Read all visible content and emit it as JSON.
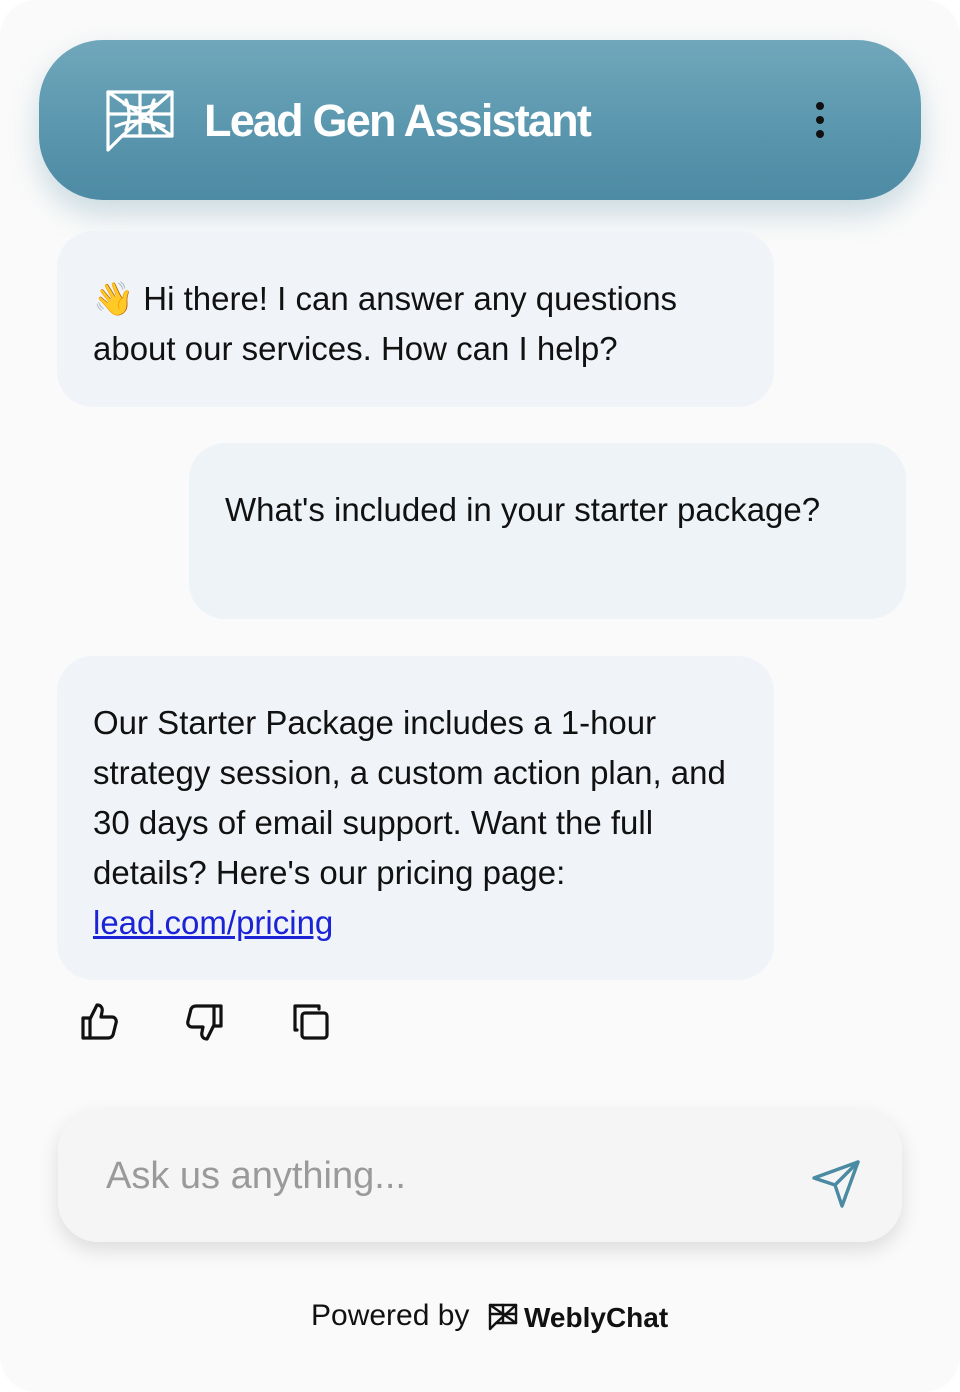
{
  "header": {
    "title": "Lead Gen Assistant",
    "logo_icon": "chat-web-logo-icon",
    "menu_icon": "vertical-dots-icon"
  },
  "messages": [
    {
      "role": "bot",
      "emoji": "👋",
      "text": " Hi there! I can answer any questions about our services. How can I help?"
    },
    {
      "role": "user",
      "text": "What's included in your starter package?"
    },
    {
      "role": "bot",
      "text": "Our Starter Package includes a 1-hour strategy session, a custom action plan, and 30 days of email support. Want the full details? Here's our pricing page: ",
      "link_text": "lead.com/pricing"
    }
  ],
  "actions": {
    "thumbs_up_icon": "thumbs-up-icon",
    "thumbs_down_icon": "thumbs-down-icon",
    "copy_icon": "copy-icon"
  },
  "input": {
    "placeholder": "Ask us anything...",
    "value": "",
    "send_icon": "send-icon"
  },
  "footer": {
    "powered_by": "Powered by",
    "brand": "WeblyChat"
  },
  "colors": {
    "header_top": "#71a7bb",
    "header_bottom": "#4d8aa3",
    "bot_bubble": "#f0f3f8",
    "user_bubble": "#edf3f7",
    "link": "#1a23d6",
    "send_icon": "#4a8aa2"
  }
}
